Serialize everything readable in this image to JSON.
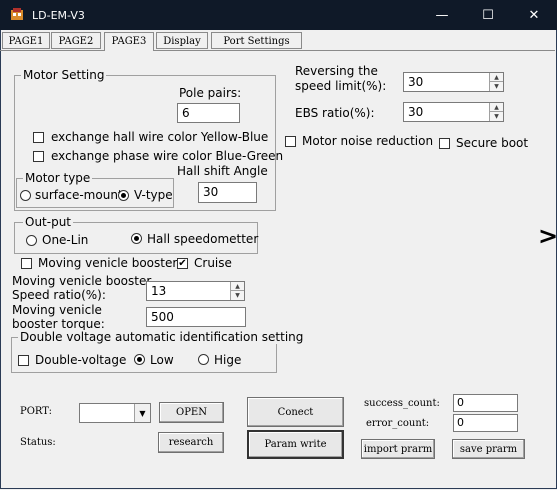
{
  "window": {
    "title": "LD-EM-V3",
    "minimize": "—",
    "maximize": "☐",
    "close": "✕"
  },
  "tabs": [
    "PAGE1",
    "PAGE2",
    "PAGE3",
    "Display",
    "Port Settings"
  ],
  "motor_setting": {
    "legend": "Motor Setting",
    "pole_pairs_label": "Pole pairs:",
    "pole_pairs_value": "6",
    "exchange_hall_label": "exchange hall wire color Yellow-Blue",
    "exchange_phase_label": "exchange phase wire color Blue-Green",
    "motor_type_legend": "Motor type",
    "surface_mount_label": "surface-mount",
    "v_type_label": "V-type",
    "hall_shift_label": "Hall shift Angle",
    "hall_shift_value": "30"
  },
  "right_panel": {
    "reversing_label_1": "Reversing the",
    "reversing_label_2": "speed limit(%):",
    "reversing_value": "30",
    "ebs_label": "EBS ratio(%):",
    "ebs_value": "30",
    "noise_label": "Motor noise reduction",
    "secure_boot_label": "Secure boot",
    "arrow": ">"
  },
  "output": {
    "legend": "Out-put",
    "one_lin_label": "One-Lin",
    "hall_speedometer_label": "Hall speedometter"
  },
  "booster": {
    "moving_booster_label": "Moving venicle booster",
    "cruise_label": "Cruise",
    "speed_ratio_label_1": "Moving venicle booster",
    "speed_ratio_label_2": "Speed ratio(%):",
    "speed_ratio_value": "13",
    "torque_label_1": "Moving venicle",
    "torque_label_2": "booster torque:",
    "torque_value": "500"
  },
  "double_voltage": {
    "legend": "Double voltage automatic identification setting",
    "double_voltage_label": "Double-voltage",
    "low_label": "Low",
    "high_label": "Hige"
  },
  "bottom": {
    "port_label": "PORT:",
    "port_value": "",
    "open_label": "OPEN",
    "status_label": "Status:",
    "research_label": "research",
    "connect_label": "Conect",
    "param_write_label": "Param write",
    "success_count_label": "success_count:",
    "success_count_value": "0",
    "error_count_label": "error_count:",
    "error_count_value": "0",
    "import_label": "import prarm",
    "save_label": "save prarm"
  }
}
